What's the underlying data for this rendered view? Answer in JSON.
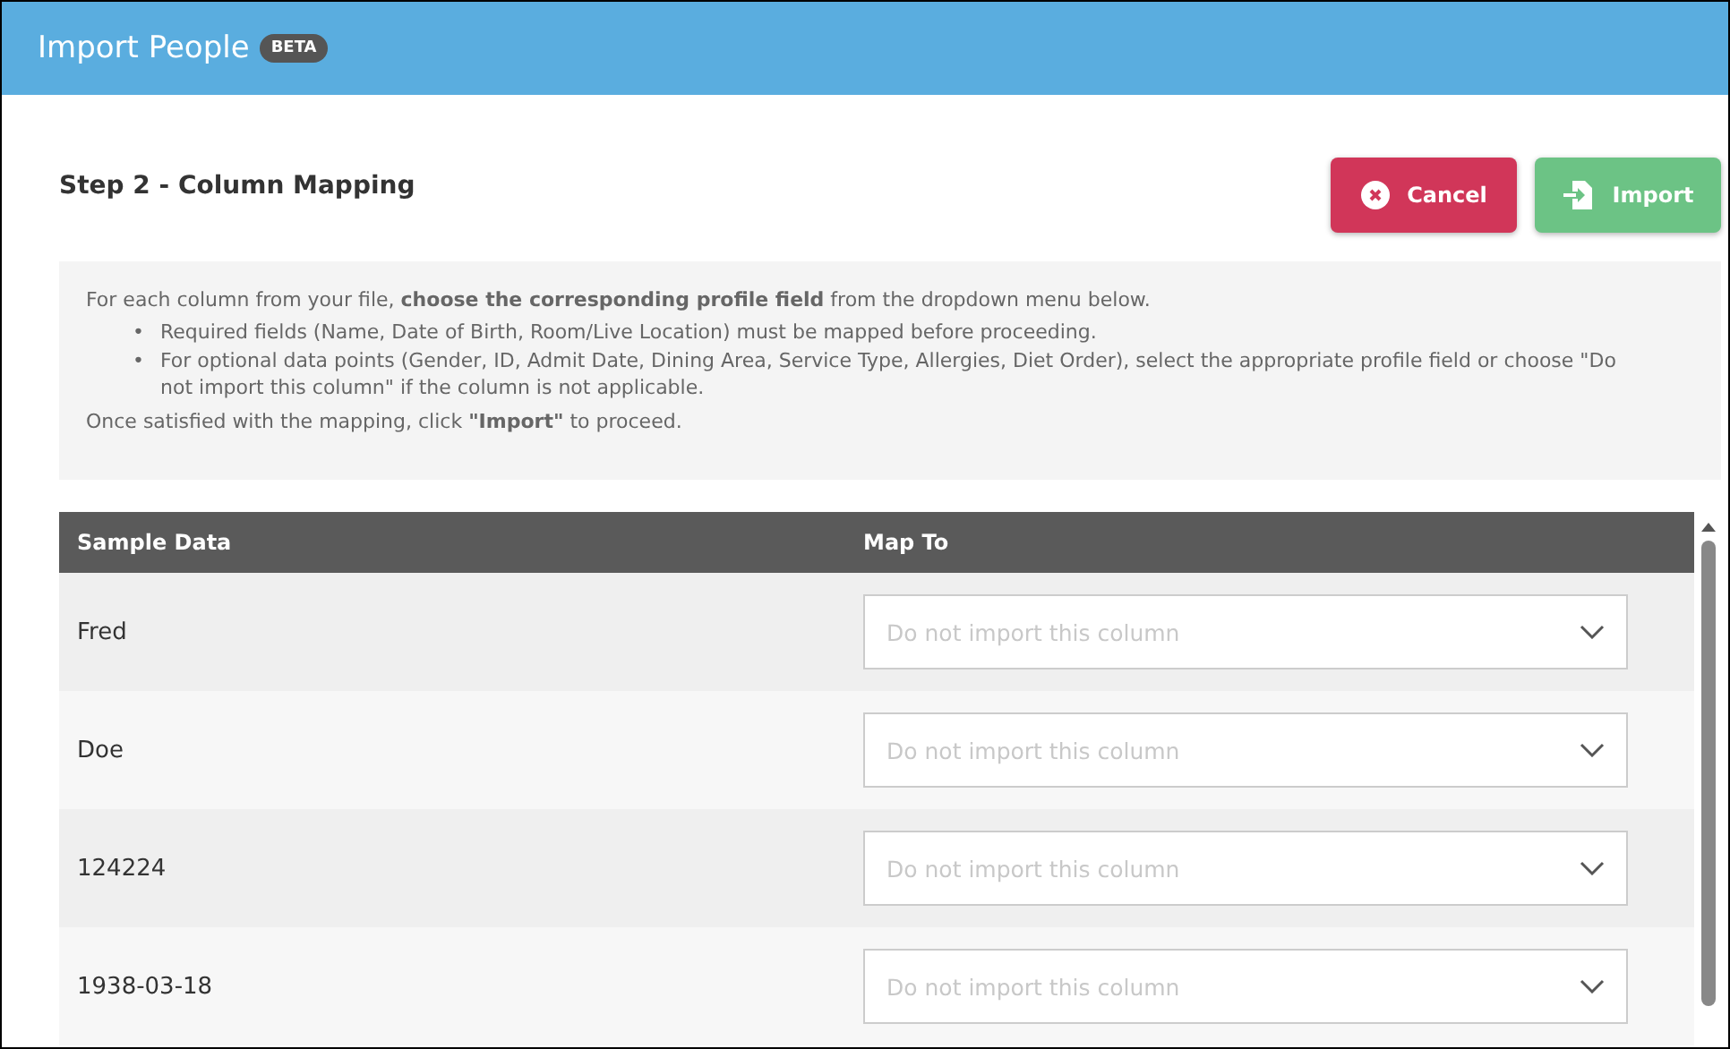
{
  "header": {
    "title": "Import People",
    "badge": "BETA"
  },
  "step_title": "Step 2 - Column Mapping",
  "buttons": [
    {
      "kind": "cancel",
      "label": "Cancel"
    },
    {
      "kind": "import",
      "label": "Import"
    }
  ],
  "instructions": {
    "intro": "For each column from your file, **choose the corresponding profile field** from the dropdown menu below.",
    "bullets": [
      {
        "marker": "•",
        "text": "Required fields (Name, Date of Birth, Room/Live Location) must be mapped before proceeding."
      },
      {
        "marker": "•",
        "text": "For optional data points (Gender, ID, Admit Date, Dining Area, Service Type, Allergies, Diet Order), select the appropriate profile field or choose \"Do not import this column\" if the column is not applicable."
      }
    ],
    "outro": "Once satisfied with the mapping, click **\"Import\"** to proceed."
  },
  "table": {
    "columns": [
      "Sample Data",
      "Map To"
    ],
    "rows": [
      {
        "sample": "Fred",
        "map_placeholder": "Do not import this column"
      },
      {
        "sample": "Doe",
        "map_placeholder": "Do not import this column"
      },
      {
        "sample": "124224",
        "map_placeholder": "Do not import this column"
      },
      {
        "sample": "1938-03-18",
        "map_placeholder": "Do not import this column"
      }
    ]
  }
}
